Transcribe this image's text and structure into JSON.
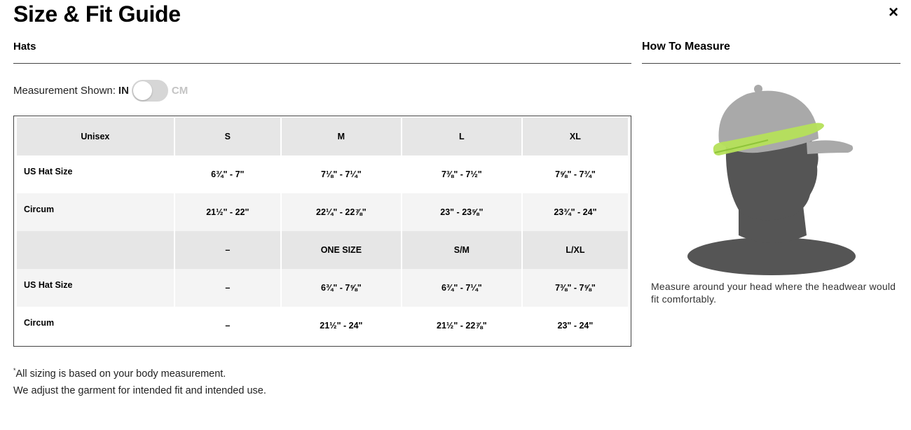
{
  "header": {
    "title": "Size & Fit Guide",
    "close_label": "×"
  },
  "hats": {
    "section_title": "Hats",
    "measurement_label": "Measurement Shown:",
    "unit_in": "IN",
    "unit_cm": "CM",
    "toggle_state": "IN"
  },
  "table": {
    "rows": [
      {
        "type": "head",
        "cells": [
          "Unisex",
          "S",
          "M",
          "L",
          "XL"
        ]
      },
      {
        "type": "plain",
        "cells": [
          "US Hat Size",
          "6¾\" - 7\"",
          "7⅛\" - 7¼\"",
          "7⅜\" - 7½\"",
          "7⅝\" - 7¾\""
        ]
      },
      {
        "type": "shade",
        "cells": [
          "Circum",
          "21½\" - 22\"",
          "22¼\" - 22⅞\"",
          "23\" - 23⅝\"",
          "23¾\" - 24\""
        ]
      },
      {
        "type": "head",
        "cells": [
          "",
          "–",
          "ONE SIZE",
          "S/M",
          "L/XL"
        ]
      },
      {
        "type": "shade",
        "cells": [
          "US Hat Size",
          "–",
          "6¾\" - 7⅝\"",
          "6¾\" - 7¼\"",
          "7⅜\" - 7⅝\""
        ]
      },
      {
        "type": "plain",
        "cells": [
          "Circum",
          "–",
          "21½\" - 24\"",
          "21½\" - 22⅞\"",
          "23\" - 24\""
        ]
      }
    ]
  },
  "footnote": {
    "star": "*",
    "line1": "All sizing is based on your body measurement.",
    "line2": "We adjust the garment for intended fit and intended use."
  },
  "how_to_measure": {
    "section_title": "How To Measure",
    "description": "Measure around your head where the headwear would fit comfortably.",
    "colors": {
      "cap": "#a9a9a9",
      "head": "#555555",
      "band": "#b5e05a"
    }
  }
}
